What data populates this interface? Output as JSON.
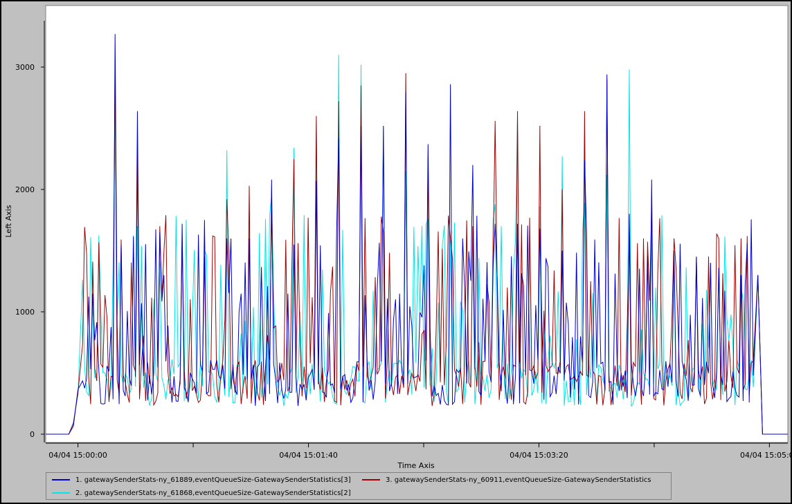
{
  "chart_data": {
    "type": "line",
    "xlabel": "Time Axis",
    "ylabel": "Left Axis",
    "x_ticks": [
      "04/04 15:00:00",
      "04/04 15:01:40",
      "04/04 15:03:20",
      "04/04 15:05:00"
    ],
    "x_range": [
      "04/04 14:59:46",
      "04/04 15:05:08"
    ],
    "y_ticks": [
      0,
      1000,
      2000,
      3000
    ],
    "ylim": [
      0,
      3400
    ],
    "grid": false,
    "legend_position": "bottom-left",
    "series": [
      {
        "name": "1. gatewaySenderStats-ny_61889,eventQueueSize-GatewaySenderStatistics[3]",
        "color": "#0000cc",
        "peaks": [
          1150,
          3270,
          2640,
          1650,
          1720,
          1750,
          1600,
          1600,
          2080,
          1550,
          2070,
          2420,
          2520,
          2520,
          2800,
          2370,
          3380,
          2860,
          2200,
          1720,
          1720,
          1680,
          1500,
          2240,
          2940,
          1800,
          2080,
          1500,
          1450,
          1360,
          1300
        ]
      },
      {
        "name": "2. gatewaySenderStats-ny_61868,eventQueueSize-GatewaySenderStatistics[2]",
        "color": "#00e5e5",
        "peaks": [
          1000,
          2720,
          1700,
          1400,
          1600,
          1500,
          2320,
          1800,
          1950,
          2340,
          2560,
          3100,
          3020,
          2500,
          2150,
          1760,
          1700,
          1580,
          1600,
          1880,
          2580,
          1860,
          2270,
          1890,
          2120,
          2980,
          1720,
          1500,
          1430,
          1360,
          1200
        ]
      },
      {
        "name": "3. gatewaySenderStats-ny_60911,eventQueueSize-GatewaySenderStatistics",
        "color": "#a00000",
        "peaks": [
          1410,
          3060,
          2280,
          1700,
          1600,
          1450,
          1920,
          2030,
          1850,
          2250,
          2600,
          2720,
          2850,
          1650,
          2950,
          2260,
          1620,
          1600,
          1700,
          2560,
          2640,
          2520,
          2000,
          2640,
          2900,
          1600,
          1880,
          1600,
          1450,
          1600,
          1600
        ]
      }
    ]
  },
  "legend": {
    "items": [
      "1. gatewaySenderStats-ny_61889,eventQueueSize-GatewaySenderStatistics[3]",
      "2. gatewaySenderStats-ny_61868,eventQueueSize-GatewaySenderStatistics[2]",
      "3. gatewaySenderStats-ny_60911,eventQueueSize-GatewaySenderStatistics"
    ]
  }
}
